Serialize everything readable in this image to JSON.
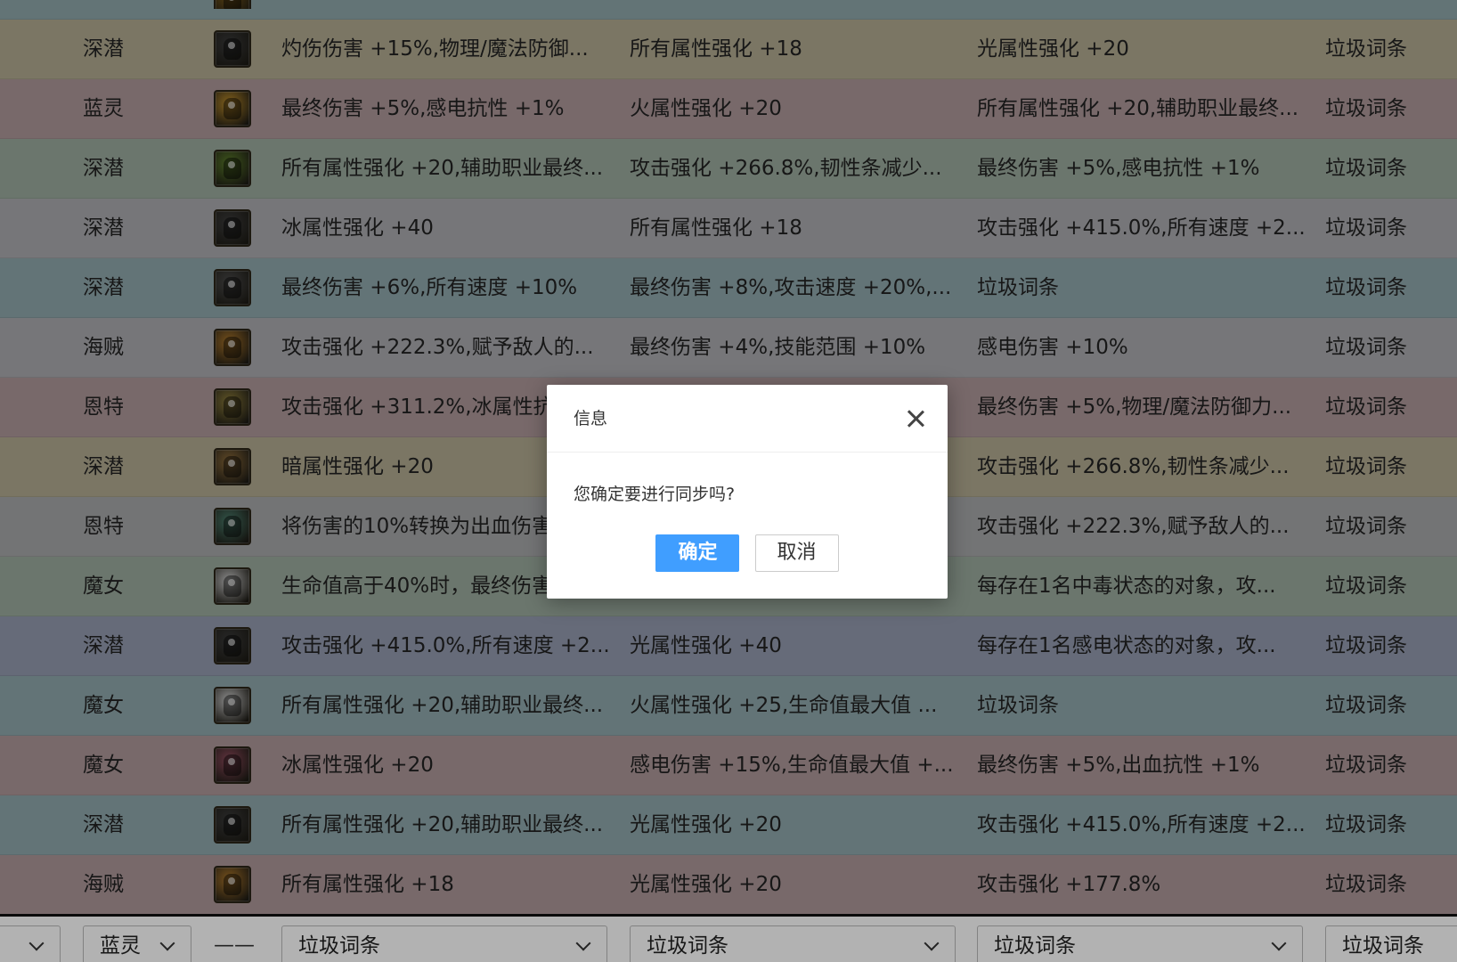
{
  "table": {
    "rows": [
      {
        "class": "",
        "icon": "",
        "a1": "",
        "a2": "",
        "a3": "",
        "a4": "",
        "bg": "#8ea6aa",
        "icon_color": "#7a5a1a",
        "partial": true
      },
      {
        "class": "深潜",
        "icon": "dark-helmet-icon",
        "a1": "灼伤伤害 +15%,物理/魔法防御...",
        "a2": "所有属性强化 +18",
        "a3": "光属性强化 +20",
        "a4": "垃圾词条",
        "bg": "#b0aa90",
        "icon_color": "#3a3a3a"
      },
      {
        "class": "蓝灵",
        "icon": "blue-flask-icon",
        "a1": "最终伤害 +5%,感电抗性 +1%",
        "a2": "火属性强化 +20",
        "a3": "所有属性强化 +20,辅助职业最终...",
        "a4": "垃圾词条",
        "bg": "#ad9799",
        "icon_color": "#b98a2a"
      },
      {
        "class": "深潜",
        "icon": "green-potion-icon",
        "a1": "所有属性强化 +20,辅助职业最终...",
        "a2": "攻击强化 +266.8%,韧性条减少...",
        "a3": "最终伤害 +5%,感电抗性 +1%",
        "a4": "垃圾词条",
        "bg": "#9aaa9c",
        "icon_color": "#5a7a2a"
      },
      {
        "class": "深潜",
        "icon": "dark-helmet-icon",
        "a1": "冰属性强化 +40",
        "a2": "所有属性强化 +18",
        "a3": "攻击强化 +415.0%,所有速度 +2...",
        "a4": "垃圾词条",
        "bg": "#a9aaae",
        "icon_color": "#3c3c3c"
      },
      {
        "class": "深潜",
        "icon": "gear-helmet-icon",
        "a1": "最终伤害 +6%,所有速度 +10%",
        "a2": "最终伤害 +8%,攻击速度 +20%,...",
        "a3": "垃圾词条",
        "a4": "垃圾词条",
        "bg": "#8fa6ab",
        "icon_color": "#4a4a4a"
      },
      {
        "class": "海贼",
        "icon": "gold-coin-icon",
        "a1": "攻击强化 +222.3%,赋予敌人的...",
        "a2": "最终伤害 +4%,技能范围 +10%",
        "a3": "感电伤害 +10%",
        "a4": "垃圾词条",
        "bg": "#a9aaae",
        "icon_color": "#a8742a"
      },
      {
        "class": "恩特",
        "icon": "gold-ring-icon",
        "a1": "攻击强化 +311.2%,冰属性抗...",
        "a2": "",
        "a3": "最终伤害 +5%,物理/魔法防御力...",
        "a4": "垃圾词条",
        "bg": "#ad9799",
        "icon_color": "#8a7a3a"
      },
      {
        "class": "深潜",
        "icon": "bronze-helmet-icon",
        "a1": "暗属性强化 +20",
        "a2": "",
        "a3": "攻击强化 +266.8%,韧性条减少...",
        "a4": "垃圾词条",
        "bg": "#b0aa90",
        "icon_color": "#8a6a3a"
      },
      {
        "class": "恩特",
        "icon": "teal-gem-icon",
        "a1": "将伤害的10%转换为出血伤害...",
        "a2": "",
        "a3": "攻击强化 +222.3%,赋予敌人的...",
        "a4": "垃圾词条",
        "bg": "#a5a6a8",
        "icon_color": "#4a7a6a"
      },
      {
        "class": "魔女",
        "icon": "white-robe-icon",
        "a1": "生命值高于40%时，最终伤害...",
        "a2": "",
        "a3": "每存在1名中毒状态的对象，攻...",
        "a4": "垃圾词条",
        "bg": "#9aaa9c",
        "icon_color": "#c8c8c8"
      },
      {
        "class": "深潜",
        "icon": "dark-helmet-icon",
        "a1": "攻击强化 +415.0%,所有速度 +2...",
        "a2": "光属性强化 +40",
        "a3": "每存在1名感电状态的对象，攻...",
        "a4": "垃圾词条",
        "bg": "#929aae",
        "icon_color": "#3a3a3a"
      },
      {
        "class": "魔女",
        "icon": "white-robe-icon",
        "a1": "所有属性强化 +20,辅助职业最终...",
        "a2": "火属性强化 +25,生命值最大值 ...",
        "a3": "垃圾词条",
        "a4": "垃圾词条",
        "bg": "#8fa6ab",
        "icon_color": "#c8c8c8"
      },
      {
        "class": "魔女",
        "icon": "purple-pouch-icon",
        "a1": "冰属性强化 +20",
        "a2": "感电伤害 +15%,生命值最大值 +...",
        "a3": "最终伤害 +5%,出血抗性 +1%",
        "a4": "垃圾词条",
        "bg": "#ad9799",
        "icon_color": "#8a4a5a"
      },
      {
        "class": "深潜",
        "icon": "dark-helmet-icon",
        "a1": "所有属性强化 +20,辅助职业最终...",
        "a2": "光属性强化 +20",
        "a3": "攻击强化 +415.0%,所有速度 +2...",
        "a4": "垃圾词条",
        "bg": "#8fa6ab",
        "icon_color": "#3a3a3a"
      },
      {
        "class": "海贼",
        "icon": "gold-coin-icon",
        "a1": "所有属性强化 +18",
        "a2": "光属性强化 +20",
        "a3": "攻击强化 +177.8%",
        "a4": "垃圾词条",
        "bg": "#ad9799",
        "icon_color": "#a8742a"
      }
    ]
  },
  "modal": {
    "title": "信息",
    "message": "您确定要进行同步吗?",
    "confirm_label": "确定",
    "cancel_label": "取消"
  },
  "filters": {
    "f0": "",
    "f1": "蓝灵",
    "dash": "——",
    "f2": "垃圾词条",
    "f3": "垃圾词条",
    "f4": "垃圾词条",
    "f5": "垃圾词条"
  }
}
